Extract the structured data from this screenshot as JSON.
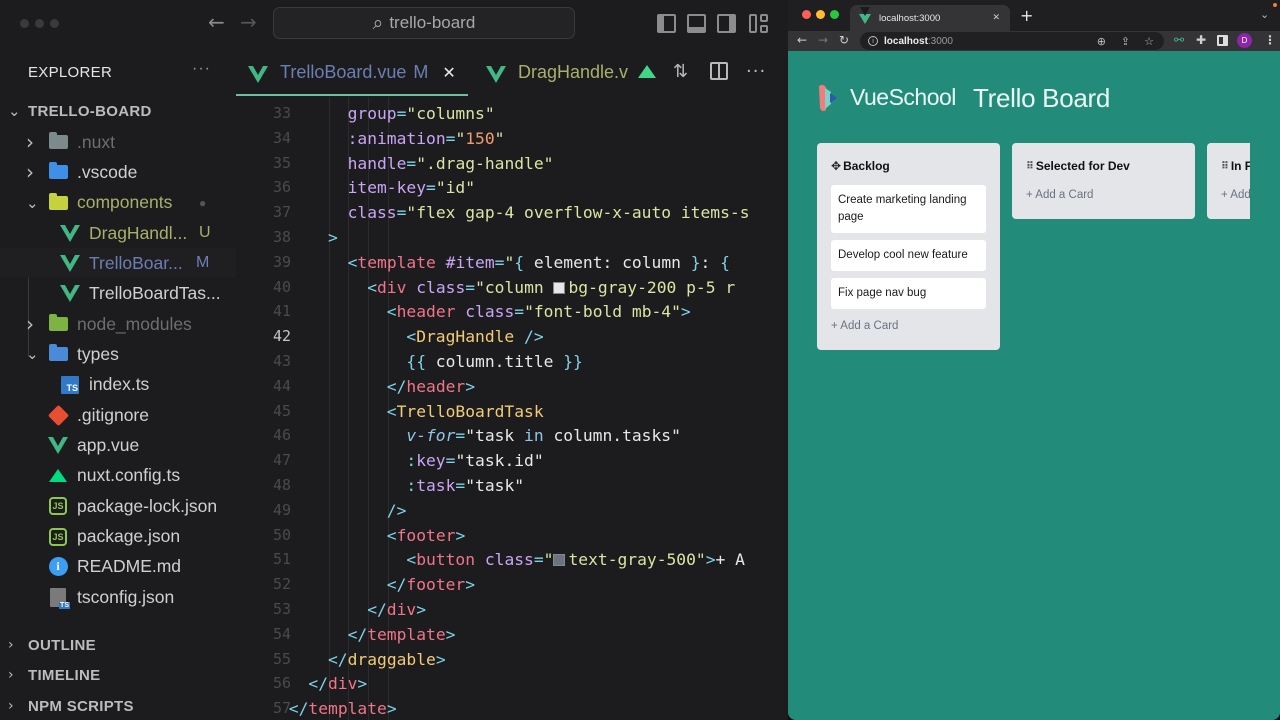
{
  "vscode": {
    "titlebar": {
      "back_icon": "←",
      "forward_icon": "→",
      "search_icon": "⌕",
      "command_center": "trello-board"
    },
    "sidebar": {
      "title": "EXPLORER",
      "more_icon": "···",
      "root_folder": "TRELLO-BOARD",
      "tree": [
        {
          "label": ".nuxt",
          "type": "folder",
          "expanded": false,
          "color": "#6e6e6e"
        },
        {
          "label": ".vscode",
          "type": "folder",
          "expanded": false,
          "color": "#d0d0d0"
        },
        {
          "label": "components",
          "type": "folder",
          "expanded": true,
          "color": "#a8b06a",
          "badge": "●"
        },
        {
          "label": "DragHandl...",
          "type": "vue",
          "color": "#a8b06a",
          "badge": "U"
        },
        {
          "label": "TrelloBoar...",
          "type": "vue",
          "color": "#6b7fb3",
          "badge": "M"
        },
        {
          "label": "TrelloBoardTas...",
          "type": "vue",
          "color": "#d0d0d0"
        },
        {
          "label": "node_modules",
          "type": "folder",
          "expanded": false,
          "color": "#6e6e6e"
        },
        {
          "label": "types",
          "type": "folder",
          "expanded": true,
          "color": "#d0d0d0"
        },
        {
          "label": "index.ts",
          "type": "ts",
          "color": "#d0d0d0"
        },
        {
          "label": ".gitignore",
          "type": "git",
          "color": "#d0d0d0"
        },
        {
          "label": "app.vue",
          "type": "vue",
          "color": "#d0d0d0"
        },
        {
          "label": "nuxt.config.ts",
          "type": "nuxt",
          "color": "#d0d0d0"
        },
        {
          "label": "package-lock.json",
          "type": "json",
          "color": "#d0d0d0"
        },
        {
          "label": "package.json",
          "type": "json",
          "color": "#d0d0d0"
        },
        {
          "label": "README.md",
          "type": "info",
          "color": "#d0d0d0"
        },
        {
          "label": "tsconfig.json",
          "type": "tsconfig",
          "color": "#d0d0d0"
        }
      ],
      "sections": [
        "OUTLINE",
        "TIMELINE",
        "NPM SCRIPTS"
      ]
    },
    "tabs": [
      {
        "label": "TrelloBoard.vue",
        "status": "M",
        "active": true,
        "close_icon": "✕"
      },
      {
        "label": "DragHandle.v",
        "active": false
      }
    ],
    "editor": {
      "current_line": 42,
      "lines": [
        {
          "n": 33,
          "indent": 3,
          "tokens": [
            [
              "attr",
              "group"
            ],
            [
              "punc",
              "="
            ],
            [
              "str",
              "\"columns\""
            ]
          ]
        },
        {
          "n": 34,
          "indent": 3,
          "tokens": [
            [
              "attr",
              ":animation"
            ],
            [
              "punc",
              "="
            ],
            [
              "str",
              "\""
            ],
            [
              "num",
              "150"
            ],
            [
              "str",
              "\""
            ]
          ]
        },
        {
          "n": 35,
          "indent": 3,
          "tokens": [
            [
              "attr",
              "handle"
            ],
            [
              "punc",
              "="
            ],
            [
              "str",
              "\".drag-handle\""
            ]
          ]
        },
        {
          "n": 36,
          "indent": 3,
          "tokens": [
            [
              "attr",
              "item-key"
            ],
            [
              "punc",
              "="
            ],
            [
              "str",
              "\"id\""
            ]
          ]
        },
        {
          "n": 37,
          "indent": 3,
          "tokens": [
            [
              "attr",
              "class"
            ],
            [
              "punc",
              "="
            ],
            [
              "str",
              "\"flex gap-4 overflow-x-auto items-s"
            ]
          ]
        },
        {
          "n": 38,
          "indent": 2,
          "tokens": [
            [
              "punc",
              ">"
            ]
          ]
        },
        {
          "n": 39,
          "indent": 3,
          "tokens": [
            [
              "punc",
              "<"
            ],
            [
              "tag",
              "template"
            ],
            [
              "plain",
              " "
            ],
            [
              "attr",
              "#item"
            ],
            [
              "punc",
              "="
            ],
            [
              "str",
              "\""
            ],
            [
              "punc",
              "{"
            ],
            [
              "plain",
              " element: column "
            ],
            [
              "punc",
              "}"
            ],
            [
              "plain",
              ": "
            ],
            [
              "punc",
              "{"
            ],
            [
              "plain",
              " "
            ]
          ]
        },
        {
          "n": 40,
          "indent": 4,
          "tokens": [
            [
              "punc",
              "<"
            ],
            [
              "tag",
              "div"
            ],
            [
              "plain",
              " "
            ],
            [
              "attr",
              "class"
            ],
            [
              "punc",
              "="
            ],
            [
              "str",
              "\"column "
            ],
            [
              "swatch",
              "#e5e7eb"
            ],
            [
              "str",
              "bg-gray-200 p-5 r"
            ]
          ]
        },
        {
          "n": 41,
          "indent": 5,
          "tokens": [
            [
              "punc",
              "<"
            ],
            [
              "tag",
              "header"
            ],
            [
              "plain",
              " "
            ],
            [
              "attr",
              "class"
            ],
            [
              "punc",
              "="
            ],
            [
              "str",
              "\"font-bold mb-4\""
            ],
            [
              "punc",
              ">"
            ]
          ]
        },
        {
          "n": 42,
          "indent": 6,
          "tokens": [
            [
              "punc",
              "<"
            ],
            [
              "comp",
              "DragHandle"
            ],
            [
              "plain",
              " "
            ],
            [
              "punc",
              "/>"
            ]
          ]
        },
        {
          "n": 43,
          "indent": 6,
          "tokens": [
            [
              "punc",
              "{{"
            ],
            [
              "plain",
              " column.title "
            ],
            [
              "punc",
              "}}"
            ]
          ]
        },
        {
          "n": 44,
          "indent": 5,
          "tokens": [
            [
              "punc",
              "</"
            ],
            [
              "tag",
              "header"
            ],
            [
              "punc",
              ">"
            ]
          ]
        },
        {
          "n": 45,
          "indent": 5,
          "tokens": [
            [
              "punc",
              "<"
            ],
            [
              "comp",
              "TrelloBoardTask"
            ]
          ]
        },
        {
          "n": 46,
          "indent": 6,
          "tokens": [
            [
              "dir",
              "v-for"
            ],
            [
              "punc",
              "="
            ],
            [
              "plain",
              "\"task "
            ],
            [
              "kw",
              "in"
            ],
            [
              "plain",
              " column.tasks\""
            ]
          ]
        },
        {
          "n": 47,
          "indent": 6,
          "tokens": [
            [
              "punc",
              ":"
            ],
            [
              "attr",
              "key"
            ],
            [
              "punc",
              "="
            ],
            [
              "plain",
              "\"task.id\""
            ]
          ]
        },
        {
          "n": 48,
          "indent": 6,
          "tokens": [
            [
              "punc",
              ":"
            ],
            [
              "attr",
              "task"
            ],
            [
              "punc",
              "="
            ],
            [
              "plain",
              "\"task\""
            ]
          ]
        },
        {
          "n": 49,
          "indent": 5,
          "tokens": [
            [
              "punc",
              "/>"
            ]
          ]
        },
        {
          "n": 50,
          "indent": 5,
          "tokens": [
            [
              "punc",
              "<"
            ],
            [
              "tag",
              "footer"
            ],
            [
              "punc",
              ">"
            ]
          ]
        },
        {
          "n": 51,
          "indent": 6,
          "tokens": [
            [
              "punc",
              "<"
            ],
            [
              "tag",
              "button"
            ],
            [
              "plain",
              " "
            ],
            [
              "attr",
              "class"
            ],
            [
              "punc",
              "="
            ],
            [
              "str",
              "\""
            ],
            [
              "swatch",
              "#6b7280"
            ],
            [
              "str",
              "text-gray-500\""
            ],
            [
              "punc",
              ">"
            ],
            [
              "plain",
              "+ A"
            ]
          ]
        },
        {
          "n": 52,
          "indent": 5,
          "tokens": [
            [
              "punc",
              "</"
            ],
            [
              "tag",
              "footer"
            ],
            [
              "punc",
              ">"
            ]
          ]
        },
        {
          "n": 53,
          "indent": 4,
          "tokens": [
            [
              "punc",
              "</"
            ],
            [
              "tag",
              "div"
            ],
            [
              "punc",
              ">"
            ]
          ]
        },
        {
          "n": 54,
          "indent": 3,
          "tokens": [
            [
              "punc",
              "</"
            ],
            [
              "tag",
              "template"
            ],
            [
              "punc",
              ">"
            ]
          ]
        },
        {
          "n": 55,
          "indent": 2,
          "tokens": [
            [
              "punc",
              "</"
            ],
            [
              "comp",
              "draggable"
            ],
            [
              "punc",
              ">"
            ]
          ]
        },
        {
          "n": 56,
          "indent": 1,
          "tokens": [
            [
              "punc",
              "</"
            ],
            [
              "tag",
              "div"
            ],
            [
              "punc",
              ">"
            ]
          ]
        },
        {
          "n": 57,
          "indent": 0,
          "tokens": [
            [
              "punc",
              "</"
            ],
            [
              "tag",
              "template"
            ],
            [
              "punc",
              ">"
            ]
          ]
        }
      ]
    }
  },
  "browser": {
    "tab_title": "localhost:3000",
    "tab_close_icon": "✕",
    "new_tab_icon": "+",
    "url_host": "localhost",
    "url_port": ":3000",
    "profile_initial": "D",
    "page": {
      "brand": "VueSchool",
      "title": "Trello Board",
      "accent_color": "#228b7a",
      "columns": [
        {
          "title": "Backlog",
          "handle": "✥",
          "tasks": [
            "Create marketing landing page",
            "Develop cool new feature",
            "Fix page nav bug"
          ],
          "add_label": "+ Add a Card"
        },
        {
          "title": "Selected for Dev",
          "handle": "⠿",
          "tasks": [],
          "add_label": "+ Add a Card"
        },
        {
          "title": "In P",
          "handle": "⠿",
          "tasks": [],
          "add_label": "+ Add a Card"
        }
      ]
    }
  }
}
